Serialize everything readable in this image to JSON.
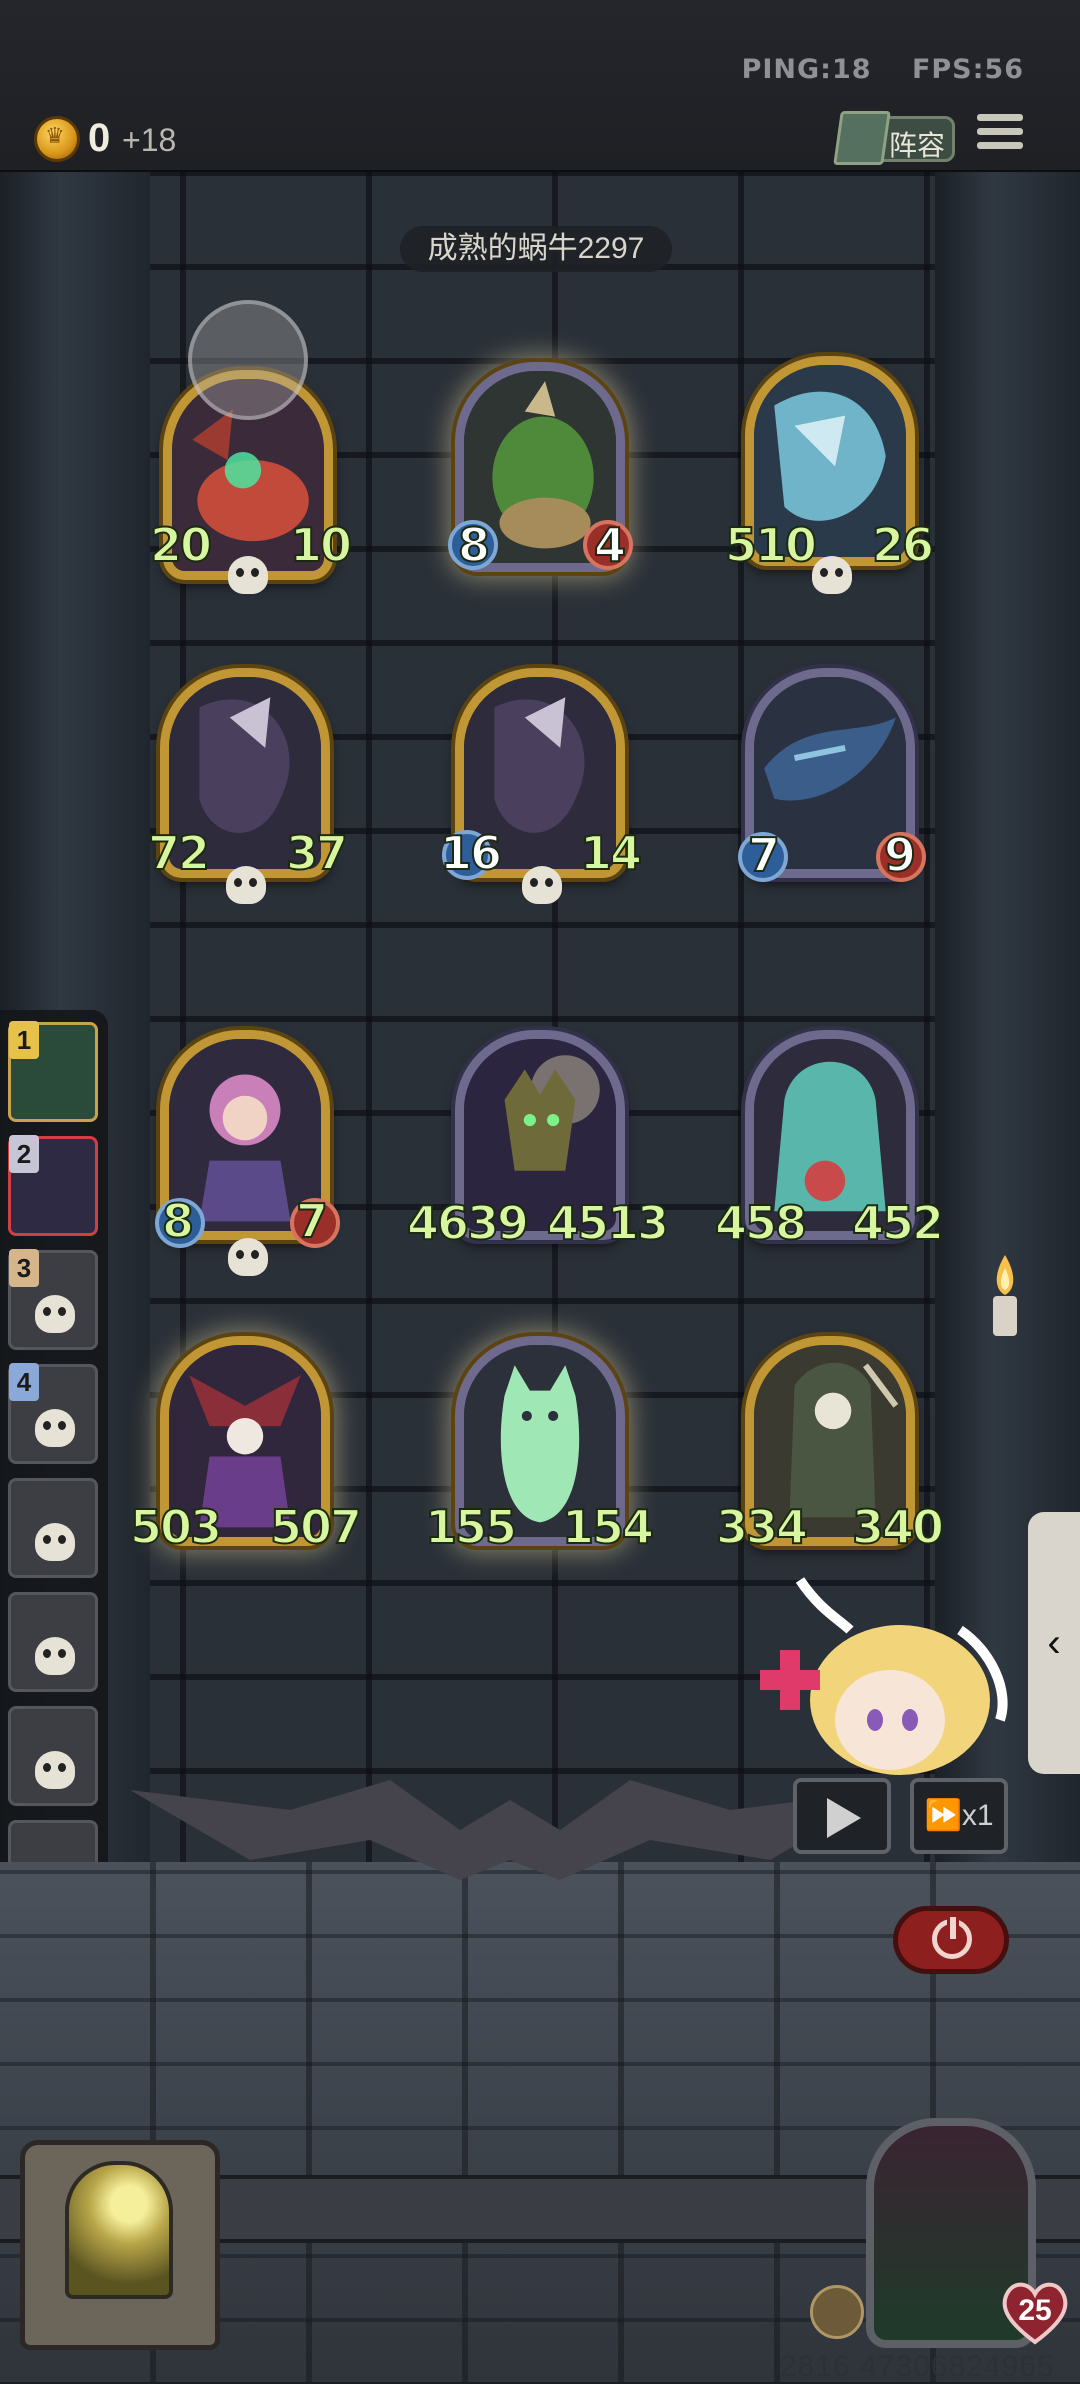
{
  "status": {
    "ping": "PING:18",
    "fps": "FPS:56"
  },
  "currency": {
    "amount": "0",
    "income": "+18"
  },
  "toolbar": {
    "lineup_label": "阵容"
  },
  "opponent": {
    "name": "成熟的蜗牛2297"
  },
  "board": {
    "opponent_cards": [
      {
        "attack": "20",
        "health": "10"
      },
      {
        "attack": "8",
        "health": "4"
      },
      {
        "attack": "510",
        "health": "26"
      },
      {
        "attack": "72",
        "health": "37"
      },
      {
        "attack": "16",
        "health": "14"
      },
      {
        "attack": "7",
        "health": "9"
      }
    ],
    "player_cards": [
      {
        "attack": "8",
        "health": "7"
      },
      {
        "attack": "4639",
        "health": "4513"
      },
      {
        "attack": "458",
        "health": "452"
      },
      {
        "attack": "503",
        "health": "507"
      },
      {
        "attack": "155",
        "health": "154"
      },
      {
        "attack": "334",
        "health": "340"
      }
    ]
  },
  "roster": {
    "badges": [
      "1",
      "2",
      "3",
      "4"
    ]
  },
  "controls": {
    "speed_label": "x1"
  },
  "hero": {
    "health": "25"
  },
  "seed": "2816 47306824965"
}
